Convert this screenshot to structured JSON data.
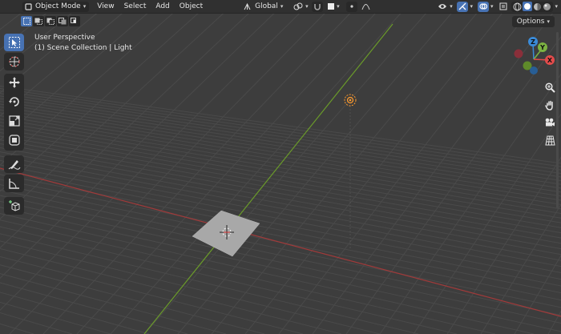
{
  "header": {
    "mode_label": "Object Mode",
    "menus": [
      "View",
      "Select",
      "Add",
      "Object"
    ],
    "transform_orientation": "Global"
  },
  "overlay": {
    "perspective": "User Perspective",
    "collection": "(1) Scene Collection | Light"
  },
  "options_label": "Options",
  "gizmo": {
    "z_label": "Z",
    "y_label": "Y",
    "x_label": "X"
  },
  "colors": {
    "accent": "#4772b3",
    "x_axis": "#e34b4b",
    "y_axis": "#7cb342",
    "z_axis": "#3a8bd8",
    "light": "#ff9b2e"
  },
  "icons": {
    "toolbar": [
      "select-box-icon",
      "cursor-icon",
      "move-icon",
      "rotate-icon",
      "scale-icon",
      "transform-icon",
      "annotate-icon",
      "measure-icon",
      "add-cube-icon"
    ],
    "navigation": [
      "zoom-icon",
      "hand-icon",
      "camera-icon",
      "grid-icon"
    ]
  }
}
